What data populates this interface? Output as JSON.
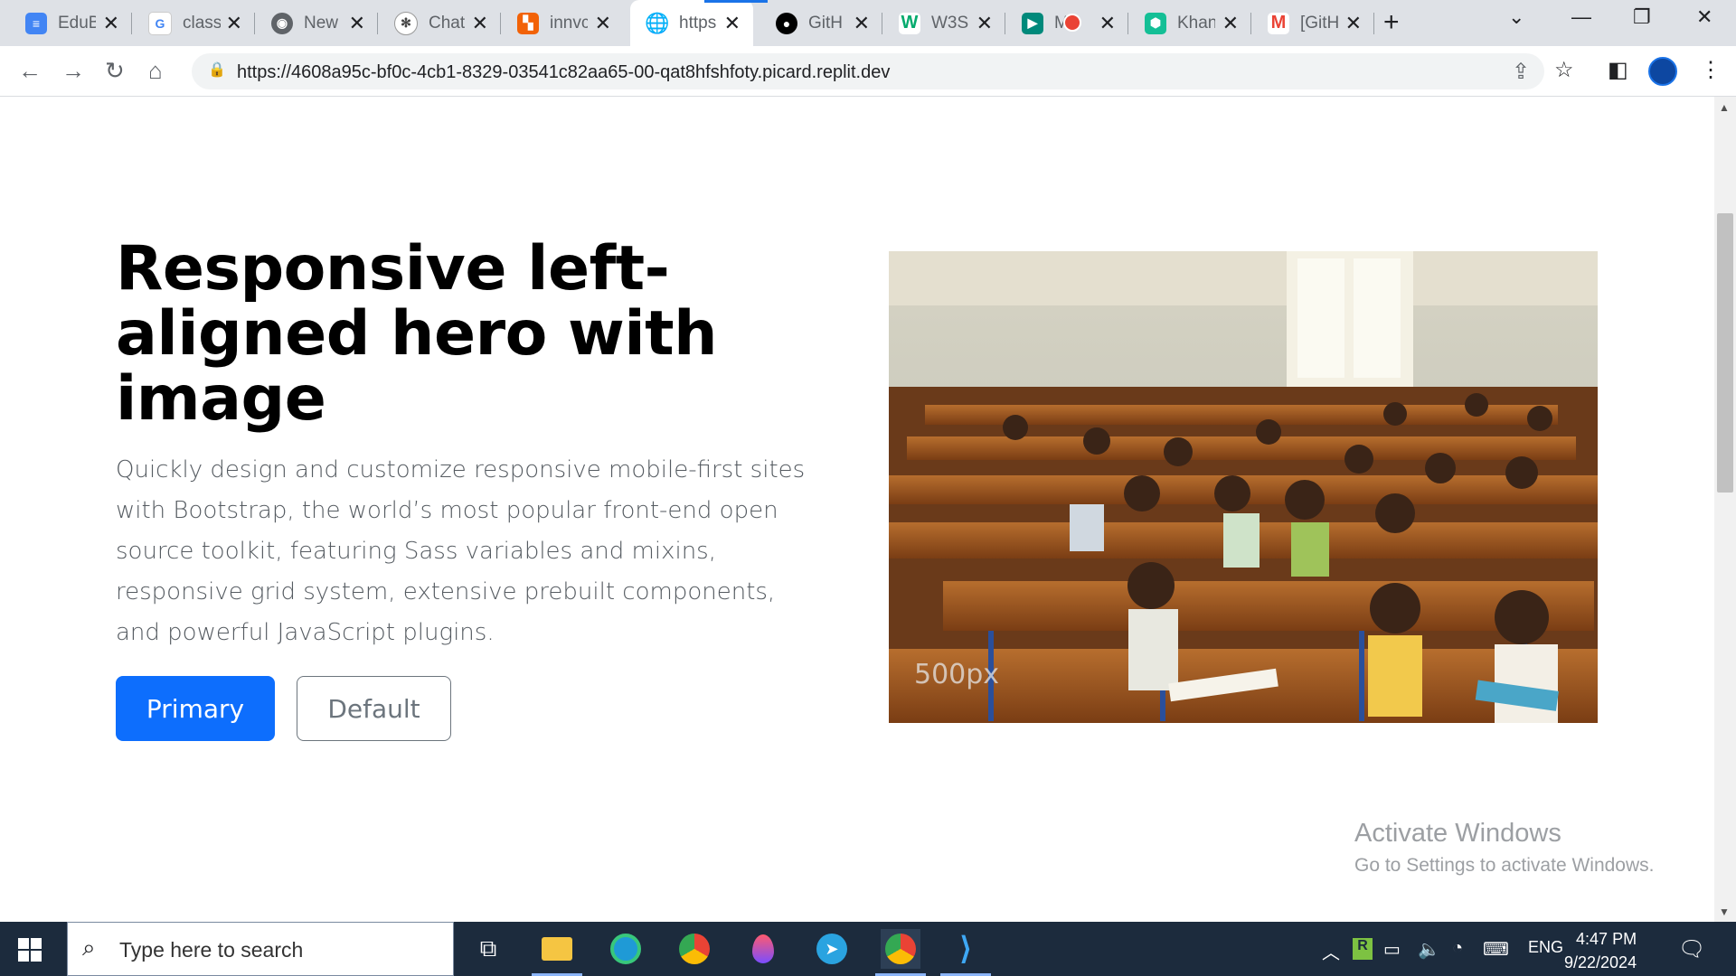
{
  "browser": {
    "tabs": [
      {
        "title": "EduB",
        "icon": "docs-icon",
        "color": "#4285f4"
      },
      {
        "title": "class",
        "icon": "google-icon",
        "color": "#ea4335"
      },
      {
        "title": "New",
        "icon": "chrome-icon",
        "color": "#5f6368"
      },
      {
        "title": "Chat",
        "icon": "openai-icon",
        "color": "#444"
      },
      {
        "title": "innvc",
        "icon": "replit-icon",
        "color": "#f26207"
      },
      {
        "title": "https",
        "icon": "globe-icon",
        "color": "#5f6368"
      },
      {
        "title": "GitH",
        "icon": "github-icon",
        "color": "#000"
      },
      {
        "title": "W3S",
        "icon": "w3schools-icon",
        "color": "#04aa6d"
      },
      {
        "title": "M",
        "icon": "meet-icon",
        "color": "#00897b"
      },
      {
        "title": "Khan",
        "icon": "khan-icon",
        "color": "#14bf96"
      },
      {
        "title": "[GitH",
        "icon": "gmail-icon",
        "color": "#ea4335"
      }
    ],
    "address": "https://4608a95c-bf0c-4cb1-8329-03541c82aa65-00-qat8hfshfoty.picard.replit.dev"
  },
  "hero": {
    "title": "Responsive left-aligned hero with image",
    "lead": "Quickly design and customize responsive mobile-first sites with Bootstrap, the world’s most popular front-end open source toolkit, featuring Sass variables and mixins, responsive grid system, extensive prebuilt components, and powerful JavaScript plugins.",
    "primary_label": "Primary",
    "default_label": "Default",
    "image_watermark": "500px"
  },
  "watermark": {
    "title": "Activate Windows",
    "subtitle": "Go to Settings to activate Windows."
  },
  "taskbar": {
    "search_placeholder": "Type here to search",
    "language": "ENG",
    "time": "4:47 PM",
    "date": "9/22/2024"
  }
}
